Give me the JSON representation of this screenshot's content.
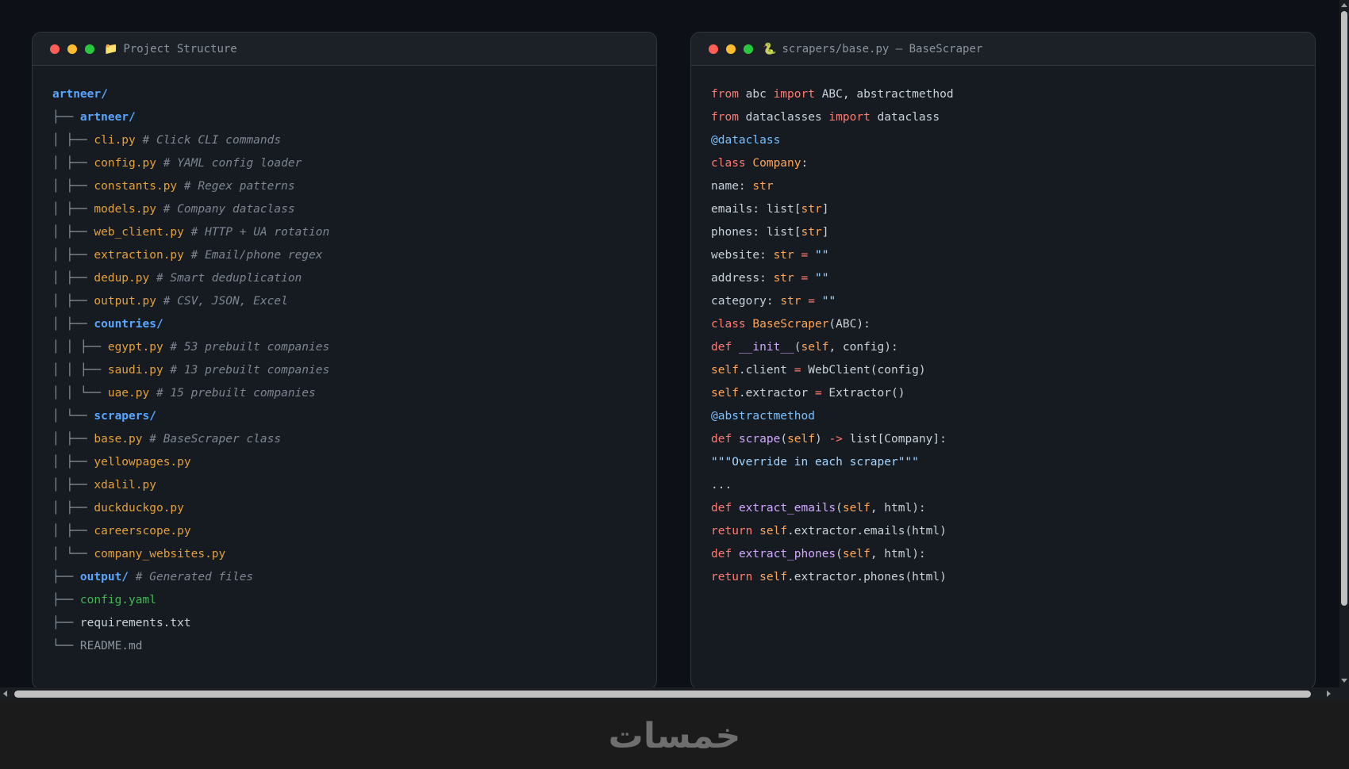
{
  "left_window": {
    "icon": "folder-icon",
    "title": "Project Structure",
    "lines": [
      [
        [
          "artneer/",
          "dir"
        ]
      ],
      [
        [
          "├── ",
          "tr"
        ],
        [
          "artneer/",
          "dir"
        ]
      ],
      [
        [
          "│ ├── ",
          "tr"
        ],
        [
          "cli.py",
          "py"
        ],
        [
          " # Click CLI commands",
          "cm"
        ]
      ],
      [
        [
          "│ ├── ",
          "tr"
        ],
        [
          "config.py",
          "py"
        ],
        [
          " # YAML config loader",
          "cm"
        ]
      ],
      [
        [
          "│ ├── ",
          "tr"
        ],
        [
          "constants.py",
          "py"
        ],
        [
          " # Regex patterns",
          "cm"
        ]
      ],
      [
        [
          "│ ├── ",
          "tr"
        ],
        [
          "models.py",
          "py"
        ],
        [
          " # Company dataclass",
          "cm"
        ]
      ],
      [
        [
          "│ ├── ",
          "tr"
        ],
        [
          "web_client.py",
          "py"
        ],
        [
          " # HTTP + UA rotation",
          "cm"
        ]
      ],
      [
        [
          "│ ├── ",
          "tr"
        ],
        [
          "extraction.py",
          "py"
        ],
        [
          " # Email/phone regex",
          "cm"
        ]
      ],
      [
        [
          "│ ├── ",
          "tr"
        ],
        [
          "dedup.py",
          "py"
        ],
        [
          " # Smart deduplication",
          "cm"
        ]
      ],
      [
        [
          "│ ├── ",
          "tr"
        ],
        [
          "output.py",
          "py"
        ],
        [
          " # CSV, JSON, Excel",
          "cm"
        ]
      ],
      [
        [
          "│ ├── ",
          "tr"
        ],
        [
          "countries/",
          "dir"
        ]
      ],
      [
        [
          "│ │ ├── ",
          "tr"
        ],
        [
          "egypt.py",
          "py"
        ],
        [
          " # 53 prebuilt companies",
          "cm"
        ]
      ],
      [
        [
          "│ │ ├── ",
          "tr"
        ],
        [
          "saudi.py",
          "py"
        ],
        [
          " # 13 prebuilt companies",
          "cm"
        ]
      ],
      [
        [
          "│ │ └── ",
          "tr"
        ],
        [
          "uae.py",
          "py"
        ],
        [
          " # 15 prebuilt companies",
          "cm"
        ]
      ],
      [
        [
          "│ └── ",
          "tr"
        ],
        [
          "scrapers/",
          "dir"
        ]
      ],
      [
        [
          "│ ├── ",
          "tr"
        ],
        [
          "base.py",
          "py"
        ],
        [
          " # BaseScraper class",
          "cm"
        ]
      ],
      [
        [
          "│ ├── ",
          "tr"
        ],
        [
          "yellowpages.py",
          "py"
        ]
      ],
      [
        [
          "│ ├── ",
          "tr"
        ],
        [
          "xdalil.py",
          "py"
        ]
      ],
      [
        [
          "│ ├── ",
          "tr"
        ],
        [
          "duckduckgo.py",
          "py"
        ]
      ],
      [
        [
          "│ ├── ",
          "tr"
        ],
        [
          "careerscope.py",
          "py"
        ]
      ],
      [
        [
          "│ └── ",
          "tr"
        ],
        [
          "company_websites.py",
          "py"
        ]
      ],
      [
        [
          "├── ",
          "tr"
        ],
        [
          "output/",
          "dir"
        ],
        [
          " # Generated files",
          "cm"
        ]
      ],
      [
        [
          "├── ",
          "tr"
        ],
        [
          "config.yaml",
          "yml"
        ]
      ],
      [
        [
          "├── ",
          "tr"
        ],
        [
          "requirements.txt",
          "txt"
        ]
      ],
      [
        [
          "└── ",
          "tr"
        ],
        [
          "README.md",
          "md"
        ]
      ]
    ]
  },
  "right_window": {
    "icon": "python-snake-icon",
    "title": "scrapers/base.py — BaseScraper",
    "lines": [
      [
        [
          "from",
          "kw"
        ],
        [
          " abc ",
          "pl"
        ],
        [
          "import",
          "kw"
        ],
        [
          " ABC, abstractmethod",
          "pl"
        ]
      ],
      [
        [
          "from",
          "kw"
        ],
        [
          " dataclasses ",
          "pl"
        ],
        [
          "import",
          "kw"
        ],
        [
          " dataclass",
          "pl"
        ]
      ],
      [
        [
          "@dataclass",
          "dec"
        ]
      ],
      [
        [
          "class",
          "kw"
        ],
        [
          " ",
          "pl"
        ],
        [
          "Company",
          "cls"
        ],
        [
          ":",
          "pl"
        ]
      ],
      [
        [
          "name: ",
          "pl"
        ],
        [
          "str",
          "self"
        ]
      ],
      [
        [
          "emails: list[",
          "pl"
        ],
        [
          "str",
          "self"
        ],
        [
          "]",
          "pl"
        ]
      ],
      [
        [
          "phones: list[",
          "pl"
        ],
        [
          "str",
          "self"
        ],
        [
          "]",
          "pl"
        ]
      ],
      [
        [
          "website: ",
          "pl"
        ],
        [
          "str",
          "self"
        ],
        [
          " ",
          "pl"
        ],
        [
          "=",
          "kw"
        ],
        [
          " ",
          "pl"
        ],
        [
          "\"\"",
          "str"
        ]
      ],
      [
        [
          "address: ",
          "pl"
        ],
        [
          "str",
          "self"
        ],
        [
          " ",
          "pl"
        ],
        [
          "=",
          "kw"
        ],
        [
          " ",
          "pl"
        ],
        [
          "\"\"",
          "str"
        ]
      ],
      [
        [
          "category: ",
          "pl"
        ],
        [
          "str",
          "self"
        ],
        [
          " ",
          "pl"
        ],
        [
          "=",
          "kw"
        ],
        [
          " ",
          "pl"
        ],
        [
          "\"\"",
          "str"
        ]
      ],
      [
        [
          "class",
          "kw"
        ],
        [
          " ",
          "pl"
        ],
        [
          "BaseScraper",
          "cls"
        ],
        [
          "(ABC):",
          "pl"
        ]
      ],
      [
        [
          "def",
          "kw"
        ],
        [
          " ",
          "pl"
        ],
        [
          "__init__",
          "fn"
        ],
        [
          "(",
          "pl"
        ],
        [
          "self",
          "self"
        ],
        [
          ", config):",
          "pl"
        ]
      ],
      [
        [
          "self",
          "self"
        ],
        [
          ".client ",
          "pl"
        ],
        [
          "=",
          "kw"
        ],
        [
          " WebClient(config)",
          "pl"
        ]
      ],
      [
        [
          "self",
          "self"
        ],
        [
          ".extractor ",
          "pl"
        ],
        [
          "=",
          "kw"
        ],
        [
          " Extractor()",
          "pl"
        ]
      ],
      [
        [
          "@abstractmethod",
          "dec"
        ]
      ],
      [
        [
          "def",
          "kw"
        ],
        [
          " ",
          "pl"
        ],
        [
          "scrape",
          "fn"
        ],
        [
          "(",
          "pl"
        ],
        [
          "self",
          "self"
        ],
        [
          ") ",
          "pl"
        ],
        [
          "->",
          "kw"
        ],
        [
          " list[Company]:",
          "pl"
        ]
      ],
      [
        [
          "\"\"\"Override in each scraper\"\"\"",
          "str"
        ]
      ],
      [
        [
          "...",
          "pl"
        ]
      ],
      [
        [
          "def",
          "kw"
        ],
        [
          " ",
          "pl"
        ],
        [
          "extract_emails",
          "fn"
        ],
        [
          "(",
          "pl"
        ],
        [
          "self",
          "self"
        ],
        [
          ", html):",
          "pl"
        ]
      ],
      [
        [
          "return",
          "kw"
        ],
        [
          " ",
          "pl"
        ],
        [
          "self",
          "self"
        ],
        [
          ".extractor.emails(html)",
          "pl"
        ]
      ],
      [
        [
          "def",
          "kw"
        ],
        [
          " ",
          "pl"
        ],
        [
          "extract_phones",
          "fn"
        ],
        [
          "(",
          "pl"
        ],
        [
          "self",
          "self"
        ],
        [
          ", html):",
          "pl"
        ]
      ],
      [
        [
          "return",
          "kw"
        ],
        [
          " ",
          "pl"
        ],
        [
          "self",
          "self"
        ],
        [
          ".extractor.phones(html)",
          "pl"
        ]
      ]
    ]
  },
  "footer": {
    "logo_text": "خمسات"
  },
  "colors": {
    "background": "#0d1117",
    "window": "#161b22",
    "titlebar": "#1c2128",
    "dot_red": "#ff5f57",
    "dot_yellow": "#febc2e",
    "dot_green": "#28c840",
    "directory": "#58a6ff",
    "python_file": "#e3a03b",
    "comment": "#7d8590",
    "keyword": "#ff7b72",
    "string": "#a5d6ff"
  }
}
